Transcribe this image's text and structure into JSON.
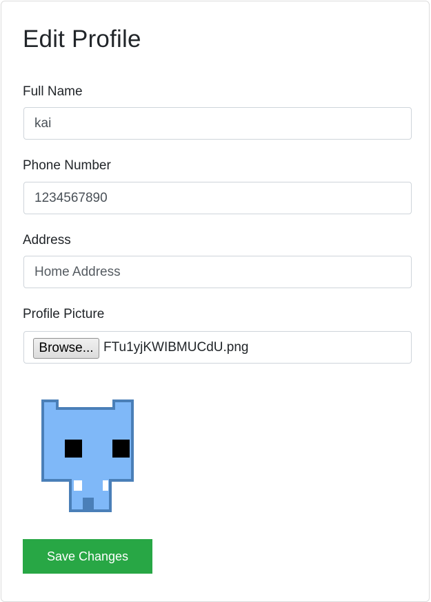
{
  "page": {
    "title": "Edit Profile"
  },
  "form": {
    "full_name": {
      "label": "Full Name",
      "value": "kai"
    },
    "phone_number": {
      "label": "Phone Number",
      "value": "1234567890"
    },
    "address": {
      "label": "Address",
      "value": "",
      "placeholder": "Home Address"
    },
    "profile_picture": {
      "label": "Profile Picture",
      "browse_label": "Browse...",
      "file_name": "FTu1yjKWIBMUCdU.png"
    },
    "save_label": "Save Changes"
  },
  "colors": {
    "save_button": "#28a745",
    "avatar_fill": "#7fb8f8",
    "avatar_outline": "#4a7fb8"
  },
  "icons": {
    "avatar": "pixel-blue-creature"
  }
}
